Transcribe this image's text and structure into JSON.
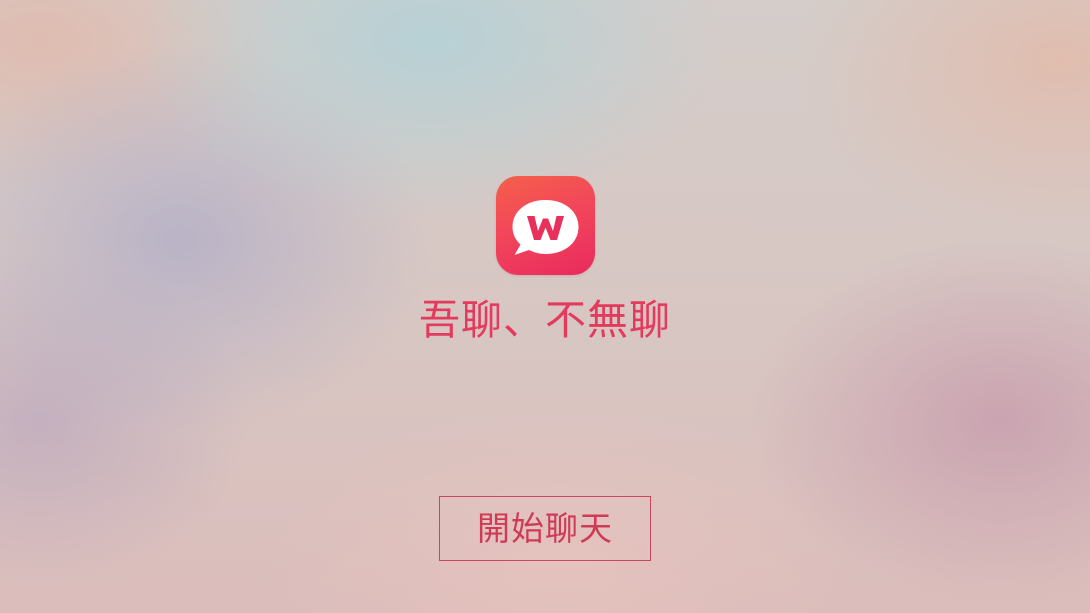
{
  "app_icon": {
    "name": "speech-bubble-w-logo",
    "letter": "W",
    "colors": {
      "top": "#f5604a",
      "bottom": "#ea2a5e",
      "bubble": "#ffffff",
      "letter": "#e8305a"
    }
  },
  "slogan": "吾聊、不無聊",
  "start_button": {
    "label": "開始聊天"
  },
  "colors": {
    "accent": "#e33a5d",
    "button_border": "#c9475e"
  }
}
